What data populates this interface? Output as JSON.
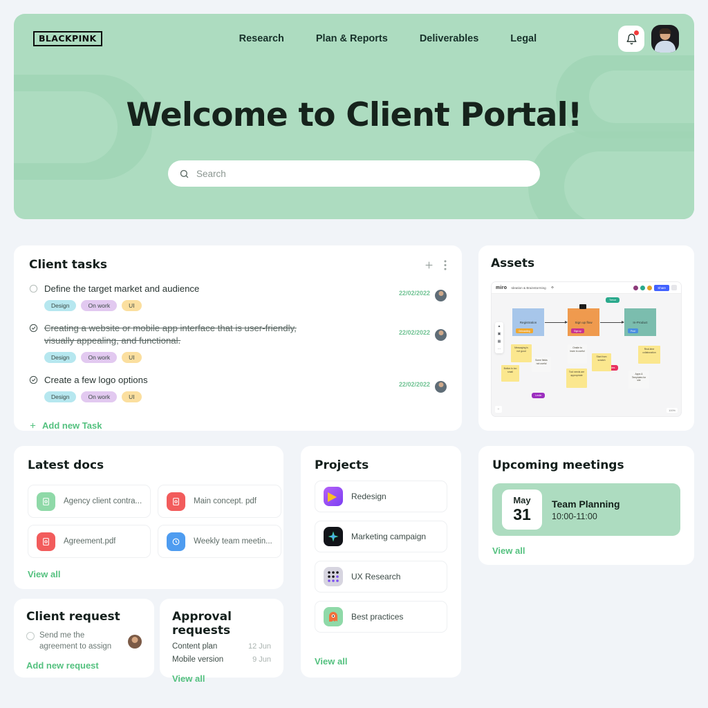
{
  "header": {
    "logo_text": "BLACKPINK",
    "nav": [
      {
        "label": "Research"
      },
      {
        "label": "Plan & Reports"
      },
      {
        "label": "Deliverables"
      },
      {
        "label": "Legal"
      }
    ],
    "notification_icon": "bell-icon",
    "has_notification_dot": true,
    "avatar_icon": "user-avatar"
  },
  "hero": {
    "title": "Welcome to Client Portal!",
    "search_placeholder": "Search",
    "search_value": "",
    "background_color": "#addcc0"
  },
  "tasks": {
    "title": "Client tasks",
    "add_icon": "plus-icon",
    "menu_icon": "more-vertical-icon",
    "add_new_label": "Add new Task",
    "items": [
      {
        "text": "Define the target market and audience",
        "done": false,
        "strikethrough": false,
        "date": "22/02/2022",
        "tags": [
          "Design",
          "On work",
          "UI"
        ]
      },
      {
        "text": "Creating a website or mobile app interface that is user-friendly, visually appealing, and functional.",
        "done": true,
        "strikethrough": true,
        "date": "22/02/2022",
        "tags": [
          "Design",
          "On work",
          "UI"
        ]
      },
      {
        "text": "Create a few logo options",
        "done": true,
        "strikethrough": false,
        "date": "22/02/2022",
        "tags": [
          "Design",
          "On work",
          "UI"
        ]
      }
    ]
  },
  "assets": {
    "title": "Assets",
    "preview": {
      "app": "miro",
      "board_name": "Ideation & Brainstorming",
      "share_label": "Share",
      "zoom_level": "100%",
      "flow_boxes": [
        {
          "label": "Registration",
          "tag": "Onboarding",
          "color": "#a7c6ea",
          "tag_color": "#f0a830"
        },
        {
          "label": "Sign up flow",
          "tag": "Sign up",
          "color": "#ef9a4e",
          "tag_color": "#c9338f"
        },
        {
          "label": "In-Product",
          "tag": "Prod",
          "color": "#7bbdae",
          "tag_color": "#4a8fe0"
        }
      ],
      "notes": [
        "Messaging is not good",
        "Button is too small",
        "Some fields not useful",
        "Onsite to learn is useful",
        "Tool needs are appropriate",
        "Start from scratch",
        "Real-time collaboration",
        "Apps & Templates for site"
      ],
      "cursors": [
        {
          "name": "Trevor",
          "color": "#2aa98c"
        },
        {
          "name": "Jules",
          "color": "#e8305f"
        },
        {
          "name": "Leslie",
          "color": "#9c2fbf"
        }
      ]
    }
  },
  "docs": {
    "title": "Latest docs",
    "view_all_label": "View all",
    "items": [
      {
        "name": "Agency client contra...",
        "icon": "doc-green-icon",
        "color": "#8fd9a8"
      },
      {
        "name": "Main concept. pdf",
        "icon": "pdf-red-icon",
        "color": "#f25c5c"
      },
      {
        "name": "Agreement.pdf",
        "icon": "pdf-red-icon",
        "color": "#f25c5c"
      },
      {
        "name": "Weekly team meetin...",
        "icon": "doc-blue-icon",
        "color": "#4e9cf0"
      }
    ]
  },
  "projects": {
    "title": "Projects",
    "view_all_label": "View all",
    "items": [
      {
        "name": "Redesign",
        "icon": "figma-arrow-icon",
        "color": "#a855f7"
      },
      {
        "name": "Marketing campaign",
        "icon": "star-dark-icon",
        "color": "#111318"
      },
      {
        "name": "UX Research",
        "icon": "dots-grid-icon",
        "color": "#d7d5e0"
      },
      {
        "name": "Best practices",
        "icon": "monster-icon",
        "color": "#8fd9a8"
      }
    ]
  },
  "meetings": {
    "title": "Upcoming meetings",
    "view_all_label": "View all",
    "event": {
      "month": "May",
      "day": "31",
      "name": "Team Planning",
      "time": "10:00-11:00"
    }
  },
  "client_request": {
    "title": "Client request",
    "request_text": "Send me the agreement to assign",
    "add_new_label": "Add new request"
  },
  "approvals": {
    "title": "Approval requests",
    "view_all_label": "View all",
    "items": [
      {
        "name": "Content plan",
        "date": "12 Jun"
      },
      {
        "name": "Mobile version",
        "date": "9 Jun"
      }
    ]
  }
}
